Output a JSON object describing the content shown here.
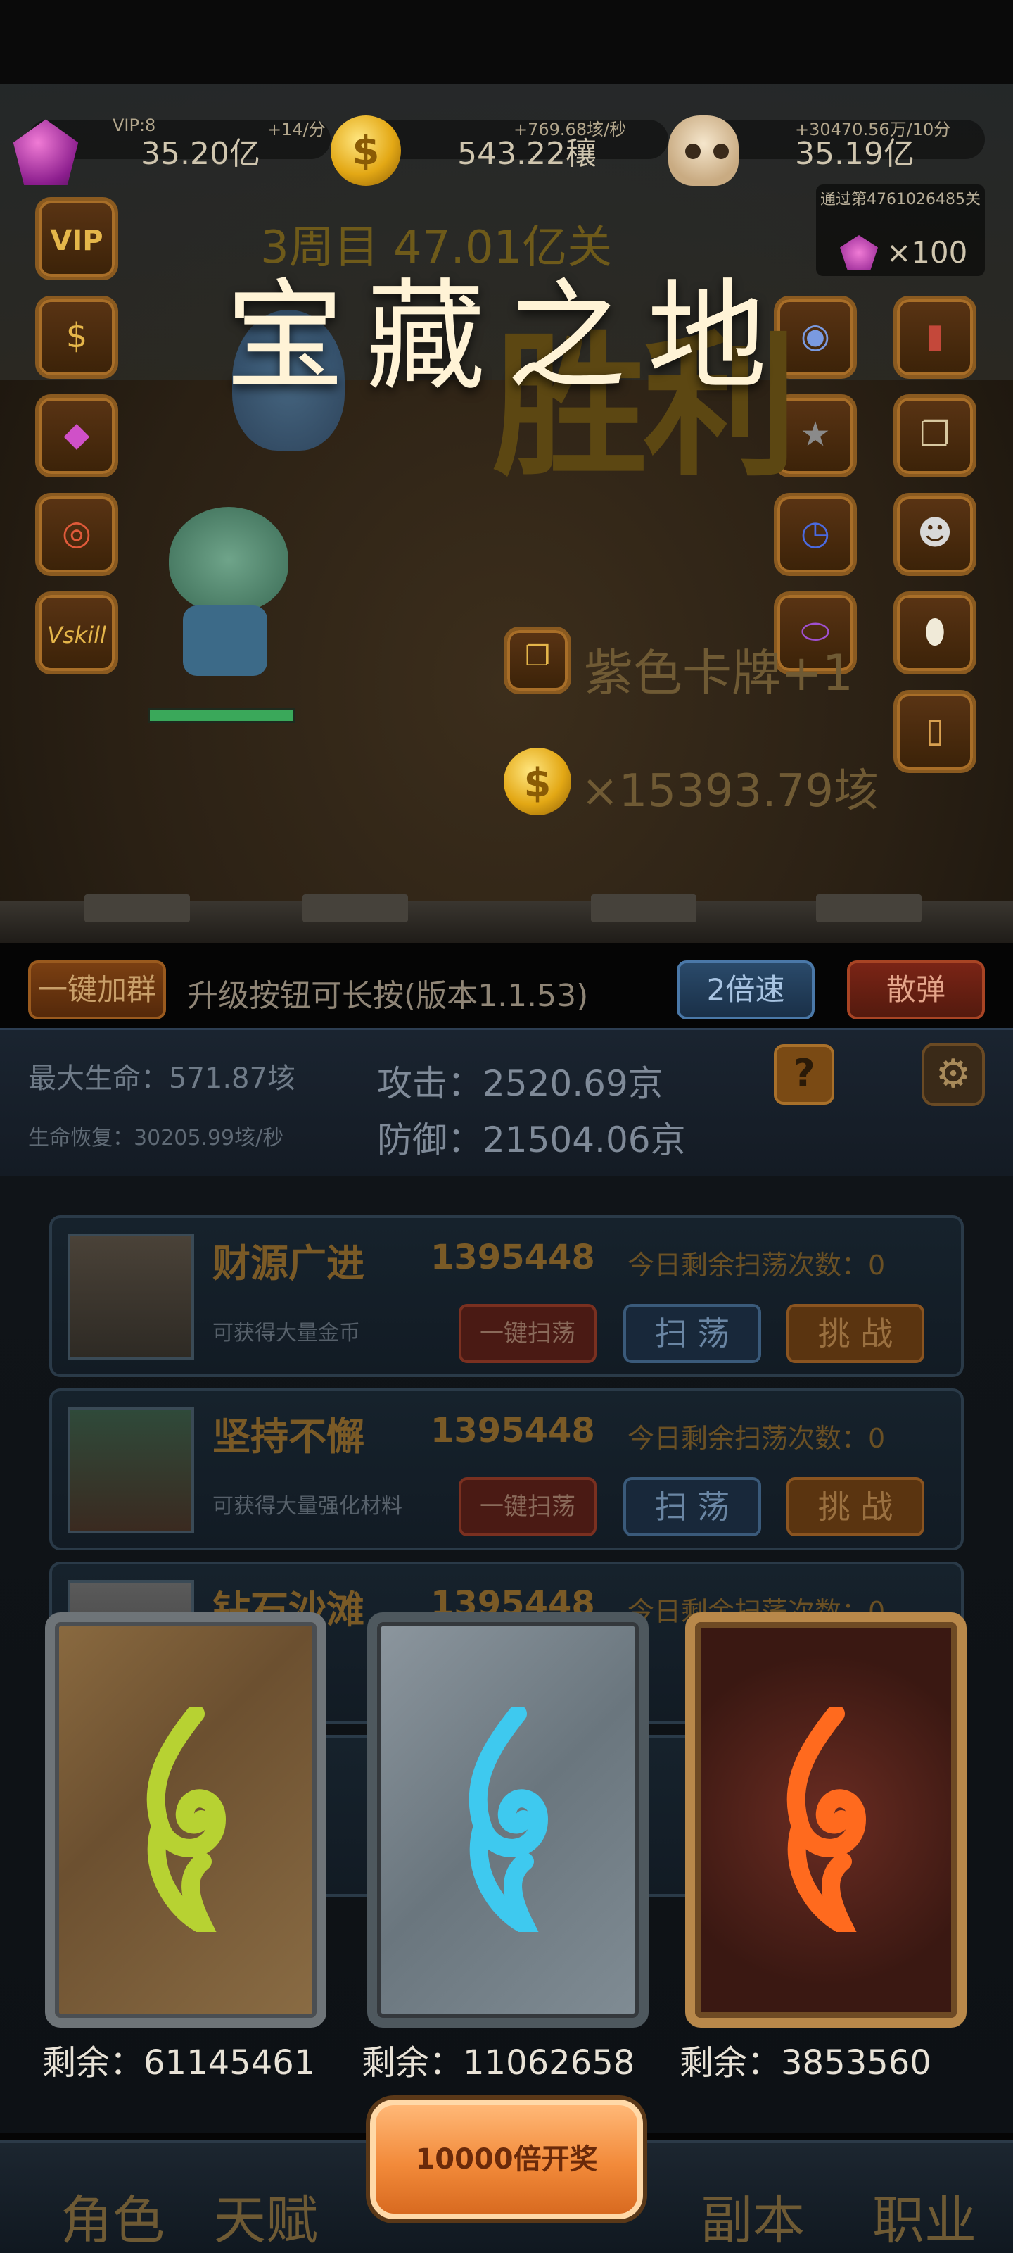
{
  "resources": {
    "gems": {
      "sub_left": "VIP:8",
      "sub_right": "+14/分",
      "value": "35.20亿",
      "icon": "gem-icon"
    },
    "coins": {
      "sub": "+769.68垓/秒",
      "value": "543.22穰",
      "icon": "coin-icon"
    },
    "skulls": {
      "sub": "+30470.56万/10分",
      "value": "35.19亿",
      "icon": "skull-icon"
    }
  },
  "reward": {
    "label": "通过第4761026485关",
    "count": "×100"
  },
  "scene": {
    "week_text": "3周目 47.01亿关",
    "victory_text": "胜利",
    "title": "宝藏之地",
    "drop_card_text": "紫色卡牌+1",
    "drop_coin_text": "×15393.79垓",
    "left_buttons": [
      "VIP",
      "$",
      "gem",
      "lifebuoy",
      "Vskill"
    ]
  },
  "controls": {
    "join_group": "一键加群",
    "version_hint": "升级按钮可长按(版本1.1.53)",
    "speed": "2倍速",
    "scatter": "散弹"
  },
  "stats": {
    "max_hp": "最大生命：571.87垓",
    "hp_regen": "生命恢复：30205.99垓/秒",
    "attack": "攻击：2520.69京",
    "defense": "防御：21504.06京",
    "help": "?"
  },
  "dungeons": [
    {
      "name": "财源广进",
      "power": "1395448",
      "sweeps": "今日剩余扫荡次数：0",
      "desc": "可获得大量金币",
      "quick_sweep": "一键扫荡",
      "sweep": "扫 荡",
      "challenge": "挑 战"
    },
    {
      "name": "坚持不懈",
      "power": "1395448",
      "sweeps": "今日剩余扫荡次数：0",
      "desc": "可获得大量强化材料",
      "quick_sweep": "一键扫荡",
      "sweep": "扫 荡",
      "challenge": "挑 战"
    },
    {
      "name": "钻石沙滩",
      "power": "1395448",
      "sweeps": "今日剩余扫荡次数：0",
      "desc": "",
      "quick_sweep": "",
      "sweep": "",
      "challenge": ""
    }
  ],
  "cards": [
    {
      "color": "green",
      "remaining": "剩余：61145461",
      "swirl": "#b7d232"
    },
    {
      "color": "blue",
      "remaining": "剩余：11062658",
      "swirl": "#3ec9ef"
    },
    {
      "color": "red",
      "remaining": "剩余：3853560",
      "swirl": "#ff6a1e"
    }
  ],
  "open_button": "10000倍开奖",
  "bottom_nav": [
    "角色",
    "天赋",
    "副本",
    "职业"
  ]
}
